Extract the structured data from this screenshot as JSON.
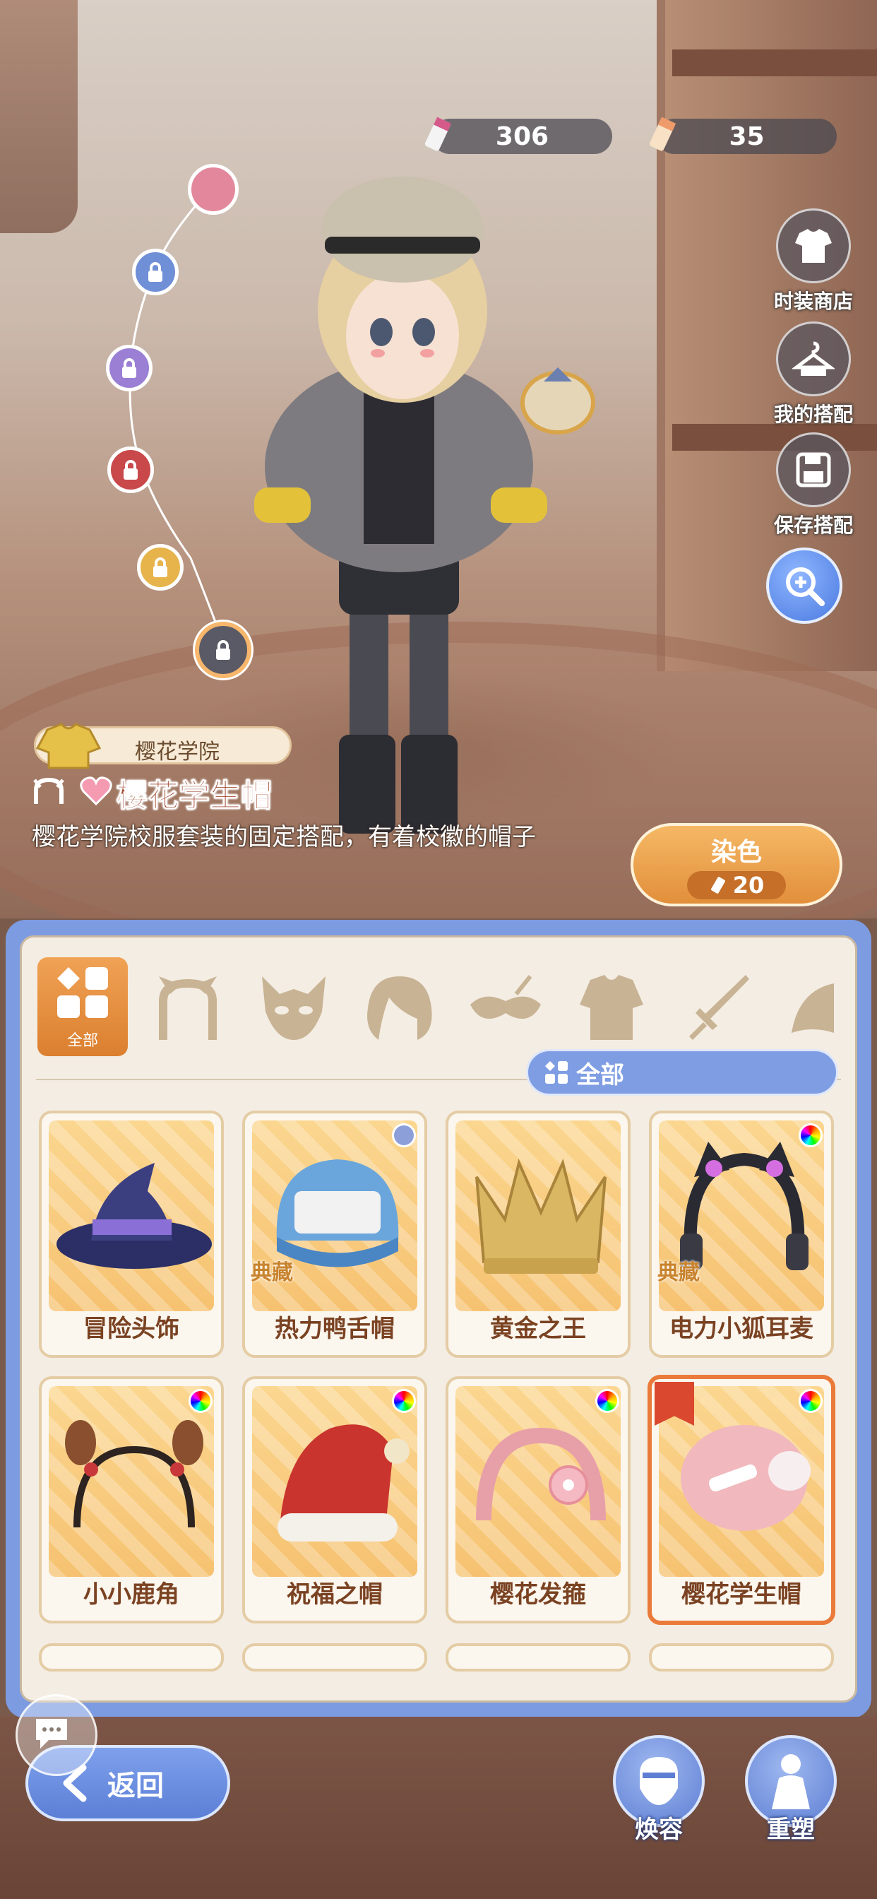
{
  "currency": {
    "primary_amount": "306",
    "secondary_amount": "35"
  },
  "side_menu": {
    "shop_label": "时装商店",
    "my_outfits_label": "我的搭配",
    "save_outfit_label": "保存搭配"
  },
  "slots": [
    {
      "color": "#e3889c"
    },
    {
      "color": "#6f8fd6"
    },
    {
      "color": "#9a7fd4"
    },
    {
      "color": "#c9484a"
    },
    {
      "color": "#e7b44c"
    },
    {
      "color": "#5a5a66"
    }
  ],
  "item": {
    "collection": "樱花学院",
    "title": "樱花学生帽",
    "description": "樱花学院校服套装的固定搭配，有着校徽的帽子"
  },
  "dye": {
    "label": "染色",
    "cost": "20"
  },
  "categories": {
    "all_label": "全部",
    "icons": [
      "cat-ears-icon",
      "mask-icon",
      "hair-icon",
      "eye-mask-icon",
      "top-icon",
      "sword-icon",
      "wing-icon"
    ]
  },
  "filter": {
    "label": "全部"
  },
  "items": [
    {
      "name": "冒险头饰",
      "marker": "none",
      "badge": ""
    },
    {
      "name": "热力鸭舌帽",
      "marker": "dot",
      "badge": "典藏"
    },
    {
      "name": "黄金之王",
      "marker": "none",
      "badge": ""
    },
    {
      "name": "电力小狐耳麦",
      "marker": "rainbow",
      "badge": "典藏"
    },
    {
      "name": "小小鹿角",
      "marker": "rainbow",
      "badge": ""
    },
    {
      "name": "祝福之帽",
      "marker": "rainbow",
      "badge": ""
    },
    {
      "name": "樱花发箍",
      "marker": "rainbow",
      "badge": ""
    },
    {
      "name": "樱花学生帽",
      "marker": "rainbow",
      "badge": "",
      "selected": true
    }
  ],
  "bottom_bar": {
    "back_label": "返回",
    "face_label": "焕容",
    "reshape_label": "重塑"
  },
  "colors": {
    "accent_orange": "#e28f3b",
    "panel_blue": "#7d9be0",
    "title_red": "#a2472e"
  }
}
